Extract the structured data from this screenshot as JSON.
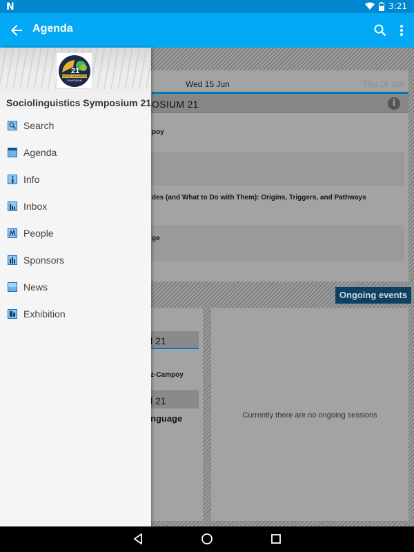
{
  "status_bar": {
    "logo": "N",
    "time": "3:21",
    "battery_level": 0.6
  },
  "app_bar": {
    "title": "Agenda"
  },
  "drawer": {
    "title": "Sociolinguistics Symposium 21",
    "logo": {
      "number": "21",
      "name": "SOCIOLINGUISTICS",
      "sub": "SYMPOSIUM"
    },
    "items": [
      {
        "label": "Search",
        "icon": "search-icon"
      },
      {
        "label": "Agenda",
        "icon": "agenda-icon"
      },
      {
        "label": "Info",
        "icon": "info-icon"
      },
      {
        "label": "Inbox",
        "icon": "inbox-icon"
      },
      {
        "label": "People",
        "icon": "people-icon"
      },
      {
        "label": "Sponsors",
        "icon": "sponsors-icon"
      },
      {
        "label": "News",
        "icon": "news-icon"
      },
      {
        "label": "Exhibition",
        "icon": "exhibition-icon"
      }
    ]
  },
  "agenda": {
    "tabs": [
      "Wed 15 Jun",
      "Thu 16 Jun"
    ],
    "session_title": "OSIUM 21",
    "events": [
      "poy",
      "",
      "des (and  What to Do with Them): Origins, Triggers, and Pathways",
      "ge",
      ""
    ]
  },
  "ongoing": {
    "label": "Ongoing events",
    "empty_text": "Currently there are no ongoing sessions"
  },
  "left_panel": {
    "header1": "l 21",
    "text1": "z-Campoy",
    "header2": "l 21",
    "text2": "nguage"
  },
  "colors": {
    "primary": "#03a9f4",
    "primary_dark": "#0288d1",
    "accent": "#0277bd",
    "ongoing_bg": "#0d4164"
  }
}
